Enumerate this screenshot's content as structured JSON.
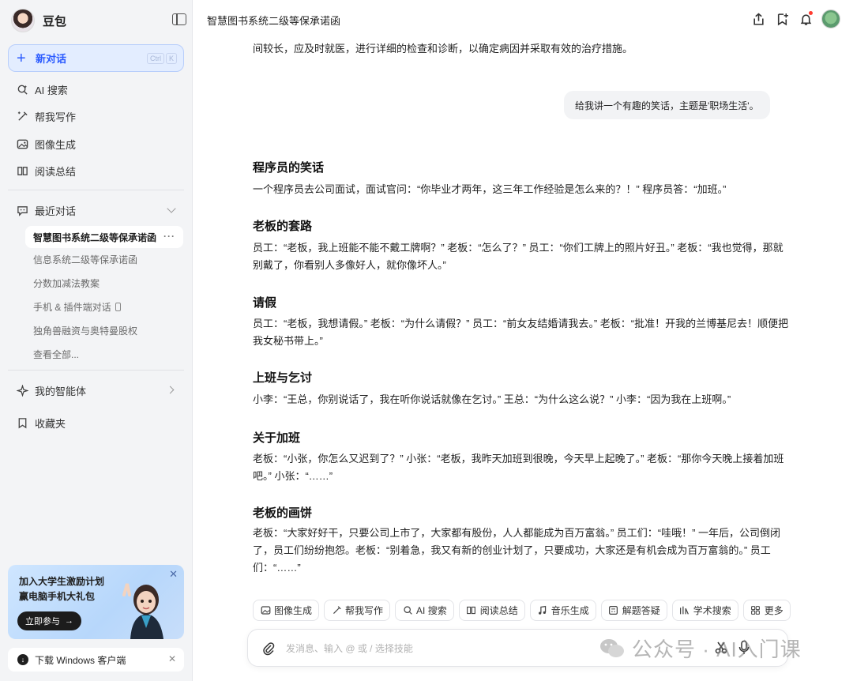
{
  "sidebar": {
    "brand": "豆包",
    "new_chat": {
      "label": "新对话",
      "kbd": [
        "Ctrl",
        "K"
      ]
    },
    "nav": [
      {
        "label": "AI 搜索",
        "icon": "search-sparkle-icon"
      },
      {
        "label": "帮我写作",
        "icon": "pen-icon"
      },
      {
        "label": "图像生成",
        "icon": "image-icon"
      },
      {
        "label": "阅读总结",
        "icon": "book-icon"
      }
    ],
    "recent_header": "最近对话",
    "recent": [
      "智慧图书系统二级等保承诺函",
      "信息系统二级等保承诺函",
      "分数加减法教案",
      "手机 & 插件端对话",
      "独角兽融资与奥特曼股权",
      "查看全部..."
    ],
    "agents": "我的智能体",
    "favorites": "收藏夹",
    "promo": {
      "line1": "加入大学生激励计划",
      "line2": "赢电脑手机大礼包",
      "button": "立即参与"
    },
    "download": "下载 Windows 客户端"
  },
  "topbar": {
    "title": "智慧图书系统二级等保承诺函"
  },
  "chat": {
    "prev_tail": "间较长，应及时就医，进行详细的检查和诊断，以确定病因并采取有效的治疗措施。",
    "user_message": "给我讲一个有趣的笑话，主题是'职场生活'。",
    "sections": [
      {
        "title": "程序员的笑话",
        "body": "一个程序员去公司面试，面试官问：“你毕业才两年，这三年工作经验是怎么来的？！” 程序员答：“加班。”"
      },
      {
        "title": "老板的套路",
        "body": "员工：“老板，我上班能不能不戴工牌啊？” 老板：“怎么了？” 员工：“你们工牌上的照片好丑。” 老板：“我也觉得，那就别戴了，你看别人多像好人，就你像坏人。”"
      },
      {
        "title": "请假",
        "body": "员工：“老板，我想请假。” 老板：“为什么请假？” 员工：“前女友结婚请我去。” 老板：“批准！开我的兰博基尼去！顺便把我女秘书带上。”"
      },
      {
        "title": "上班与乞讨",
        "body": "小李：“王总，你别说话了，我在听你说话就像在乞讨。” 王总：“为什么这么说？” 小李：“因为我在上班啊。”"
      },
      {
        "title": "关于加班",
        "body": "老板：“小张，你怎么又迟到了？” 小张：“老板，我昨天加班到很晚，今天早上起晚了。” 老板：“那你今天晚上接着加班吧。” 小张：“……”"
      },
      {
        "title": "老板的画饼",
        "body": "老板：“大家好好干，只要公司上市了，大家都有股份，人人都能成为百万富翁。” 员工们：“哇哦！” 一年后，公司倒闭了，员工们纷纷抱怨。老板：“别着急，我又有新的创业计划了，只要成功，大家还是有机会成为百万富翁的。” 员工们：“……”"
      }
    ]
  },
  "skills": [
    "图像生成",
    "帮我写作",
    "AI 搜索",
    "阅读总结",
    "音乐生成",
    "解题答疑",
    "学术搜索",
    "更多"
  ],
  "composer": {
    "placeholder": "发消息、输入 @ 或 / 选择技能"
  },
  "watermark": "公众号 · AI入门课",
  "colors": {
    "accent": "#2b5bff",
    "sidebar_bg": "#f3f4f6",
    "new_chat_bg": "#e3edff"
  }
}
